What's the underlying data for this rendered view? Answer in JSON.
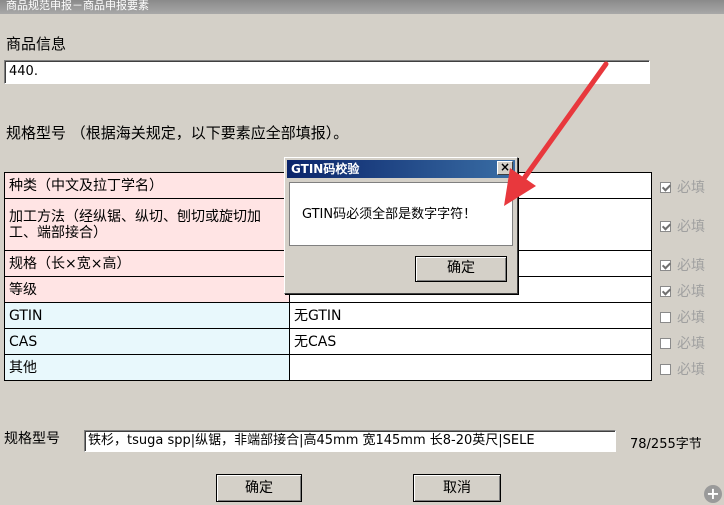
{
  "window": {
    "title": "商品规范申报－商品申报要素"
  },
  "product_info": {
    "label": "商品信息",
    "value": "440."
  },
  "spec_header": {
    "text": "规格型号 （根据海关规定，以下要素应全部填报）。"
  },
  "elements": [
    {
      "name": "种类（中文及拉丁学名）",
      "value": "",
      "required": true,
      "required_label": "必填"
    },
    {
      "name": "加工方法（经纵锯、纵切、刨切或旋切加工、端部接合）",
      "value": "",
      "required": true,
      "required_label": "必填"
    },
    {
      "name": "规格（长×宽×高）",
      "value": "",
      "required": true,
      "required_label": "必填"
    },
    {
      "name": "等级",
      "value": "",
      "required": true,
      "required_label": "必填"
    },
    {
      "name": "GTIN",
      "value": "无GTIN",
      "required": false,
      "required_label": "必填"
    },
    {
      "name": "CAS",
      "value": "无CAS",
      "required": false,
      "required_label": "必填"
    },
    {
      "name": "其他",
      "value": "",
      "required": false,
      "required_label": "必填"
    }
  ],
  "spec_model": {
    "label": "规格型号",
    "value": "铁杉，tsuga spp|纵锯，非端部接合|高45mm 宽145mm 长8-20英尺|SELE",
    "counter": "78/255字节"
  },
  "buttons": {
    "ok": "确定",
    "cancel": "取消"
  },
  "dialog": {
    "title": "GTIN码校验",
    "message": "GTIN码必须全部是数字字符！",
    "ok": "确定",
    "close": "×"
  },
  "colors": {
    "required_row": "#ffe4e4",
    "optional_row": "#e8f8fc",
    "arrow": "#e8383d",
    "dialog_title": "#0a246a"
  },
  "icons": {
    "close": "close-icon",
    "annotation": "red-arrow-icon",
    "zoom": "plus-icon"
  }
}
